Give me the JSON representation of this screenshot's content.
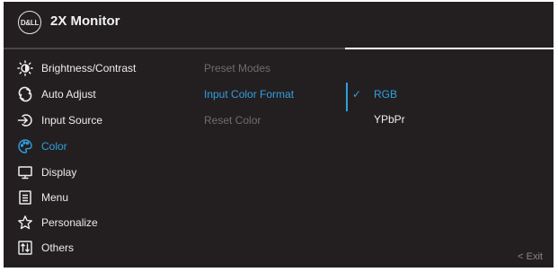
{
  "header": {
    "logo_text": "D&LL",
    "title": "2X Monitor"
  },
  "menu": {
    "items": [
      {
        "label": "Brightness/Contrast",
        "icon": "brightness-icon"
      },
      {
        "label": "Auto Adjust",
        "icon": "auto-adjust-icon"
      },
      {
        "label": "Input Source",
        "icon": "input-source-icon"
      },
      {
        "label": "Color",
        "icon": "color-palette-icon",
        "active": true
      },
      {
        "label": "Display",
        "icon": "display-icon"
      },
      {
        "label": "Menu",
        "icon": "menu-icon"
      },
      {
        "label": "Personalize",
        "icon": "star-icon"
      },
      {
        "label": "Others",
        "icon": "others-icon"
      }
    ]
  },
  "submenu": {
    "items": [
      {
        "label": "Preset Modes"
      },
      {
        "label": "Input Color Format",
        "active": true
      },
      {
        "label": "Reset Color"
      }
    ]
  },
  "options": {
    "items": [
      {
        "label": "RGB",
        "check": "✓",
        "selected": true
      },
      {
        "label": "YPbPr"
      }
    ]
  },
  "footer": {
    "exit_label": "< Exit"
  },
  "colors": {
    "background": "#231f20",
    "accent": "#2f9fe0",
    "text": "#ececec",
    "muted": "#6f6c6d"
  }
}
